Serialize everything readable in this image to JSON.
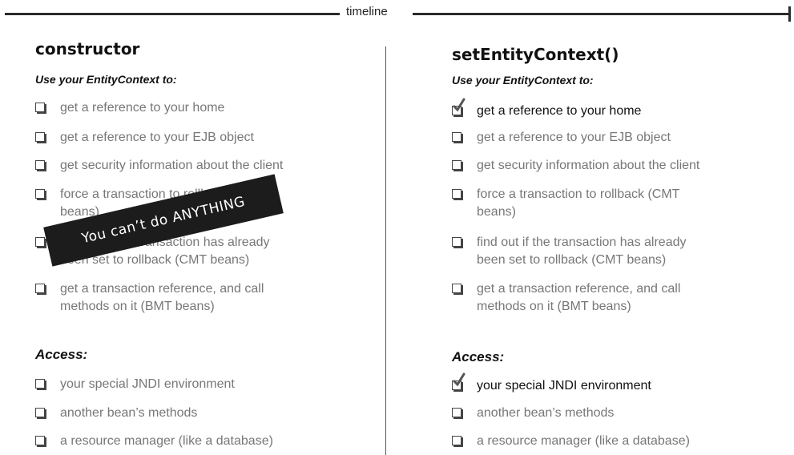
{
  "timeline": {
    "label": "timeline"
  },
  "left": {
    "heading": "constructor",
    "context_label": "Use your EntityContext to:",
    "context_items": [
      {
        "text": "get a reference to your home",
        "checked": false
      },
      {
        "text": "get a reference to your EJB object",
        "checked": false
      },
      {
        "text": "get security information about the client",
        "checked": false
      },
      {
        "text": "force a transaction to rollback (CMT beans)",
        "checked": false
      },
      {
        "text": "find out if the transaction has already been set to rollback (CMT beans)",
        "checked": false
      },
      {
        "text": "get a transaction reference, and call methods on it (BMT beans)",
        "checked": false
      }
    ],
    "access_label": "Access:",
    "access_items": [
      {
        "text": "your special JNDI environment",
        "checked": false
      },
      {
        "text": "another bean’s methods",
        "checked": false
      },
      {
        "text": "a resource manager (like a database)",
        "checked": false
      }
    ],
    "stamp": "You can’t do ANYTHING"
  },
  "right": {
    "heading": "setEntityContext()",
    "context_label": "Use your EntityContext to:",
    "context_items": [
      {
        "text": "get a reference to your home",
        "checked": true
      },
      {
        "text": "get a reference to your EJB object",
        "checked": false
      },
      {
        "text": "get security information about the client",
        "checked": false
      },
      {
        "text": "force a transaction to rollback (CMT beans)",
        "checked": false
      },
      {
        "text": "find out if the transaction has already been set to rollback (CMT beans)",
        "checked": false
      },
      {
        "text": "get a transaction reference, and call methods on it (BMT beans)",
        "checked": false
      }
    ],
    "access_label": "Access:",
    "access_items": [
      {
        "text": "your special JNDI environment",
        "checked": true
      },
      {
        "text": "another bean’s methods",
        "checked": false
      },
      {
        "text": "a resource manager (like a database)",
        "checked": false
      }
    ]
  },
  "colors": {
    "checked_text": "#111111",
    "unchecked_text": "#777777",
    "stamp_bg": "#1c1c1c"
  },
  "icons": {
    "checkbox": "checkbox-icon",
    "checkmark": "checkmark-icon"
  }
}
